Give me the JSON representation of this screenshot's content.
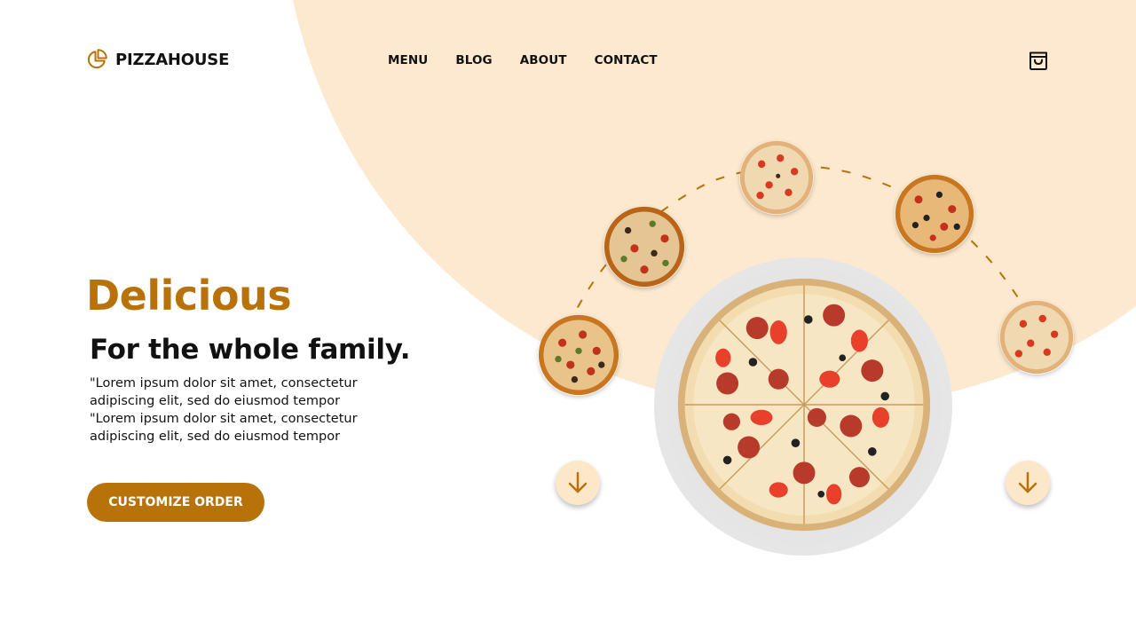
{
  "brand": {
    "name": "PIZZAHOUSE",
    "logo_icon": "pie-chart-icon",
    "accent_color": "#b8720a",
    "background_accent": "#fce9cf"
  },
  "nav": {
    "items": [
      {
        "label": "MENU"
      },
      {
        "label": "BLOG"
      },
      {
        "label": "ABOUT"
      },
      {
        "label": "CONTACT"
      }
    ]
  },
  "header": {
    "cart_icon": "shopping-bag-icon"
  },
  "hero": {
    "headline": "Delicious",
    "subheadline": "For the whole family.",
    "paragraph_lines": [
      "\"Lorem ipsum dolor sit amet, consectetur",
      "adipiscing elit, sed do eiusmod tempor",
      "\"Lorem ipsum dolor sit amet, consectetur",
      "adipiscing elit, sed do eiusmod tempor"
    ],
    "cta_label": "CUSTOMIZE ORDER"
  },
  "carousel": {
    "pizza_options": [
      "pizza-option-1",
      "pizza-option-2",
      "pizza-option-3",
      "pizza-option-4",
      "pizza-option-5"
    ],
    "left_arrow_icon": "arrow-down-icon",
    "right_arrow_icon": "arrow-down-icon"
  }
}
